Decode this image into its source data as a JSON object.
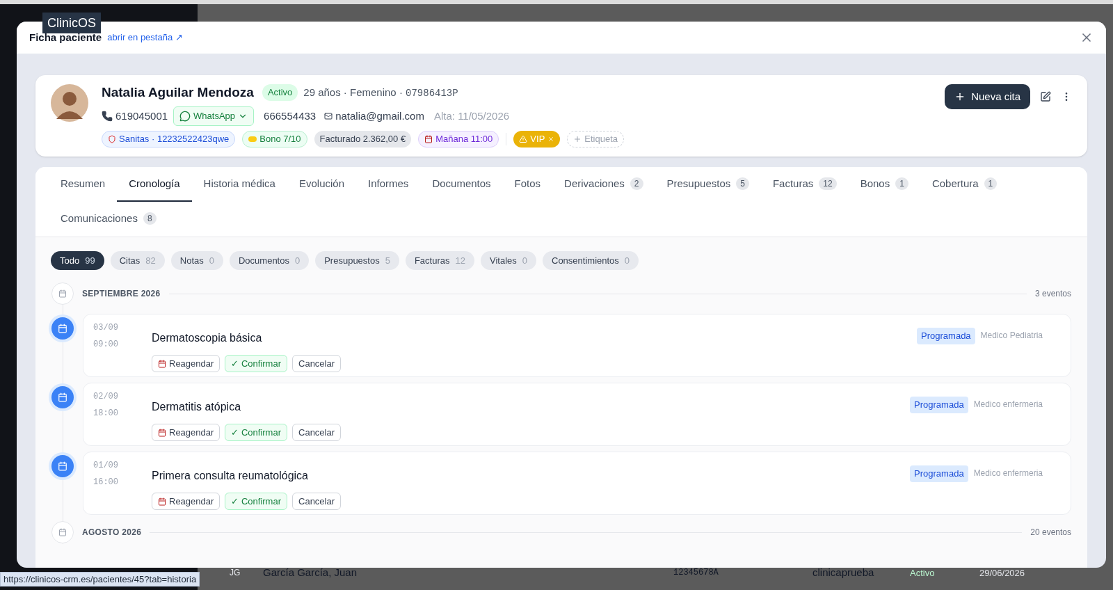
{
  "tooltip": "ClinicOS",
  "modal": {
    "title": "Ficha paciente",
    "open_tab_link": "abrir en pestaña ↗"
  },
  "patient": {
    "name": "Natalia Aguilar Mendoza",
    "status": "Activo",
    "info": "29 años · Femenino · ",
    "id": "07986413P",
    "phone": "619045001",
    "whatsapp": "WhatsApp",
    "phone2": "666554433",
    "email": "natalia@gmail.com",
    "since": "Alta: 11/05/2026",
    "tags": [
      {
        "kind": "insurance",
        "text": "Sanitas · 12232522423qwe"
      },
      {
        "kind": "bono",
        "text": "Bono 7/10"
      },
      {
        "kind": "billing",
        "text": "Facturado 2.362,00 €"
      },
      {
        "kind": "appointment",
        "text": "Mañana 11:00"
      },
      {
        "kind": "vip",
        "text": "VIP"
      },
      {
        "kind": "add",
        "text": "Etiqueta"
      }
    ],
    "new_button": "Nueva cita"
  },
  "tabs": [
    {
      "label": "Resumen",
      "selected": false
    },
    {
      "label": "Cronología",
      "selected": true
    },
    {
      "label": "Historia médica",
      "selected": false
    },
    {
      "label": "Evolución",
      "selected": false
    },
    {
      "label": "Informes",
      "selected": false
    },
    {
      "label": "Documentos",
      "selected": false
    },
    {
      "label": "Fotos",
      "selected": false
    },
    {
      "label": "Derivaciones",
      "count": "2",
      "selected": false
    },
    {
      "label": "Presupuestos",
      "count": "5",
      "selected": false
    },
    {
      "label": "Facturas",
      "count": "12",
      "selected": false
    },
    {
      "label": "Bonos",
      "count": "1",
      "selected": false
    },
    {
      "label": "Cobertura",
      "count": "1",
      "selected": false
    },
    {
      "label": "Comunicaciones",
      "count": "8",
      "selected": false
    }
  ],
  "filters": [
    {
      "label": "Todo",
      "count": "99",
      "selected": true
    },
    {
      "label": "Citas",
      "count": "82",
      "selected": false
    },
    {
      "label": "Notas",
      "count": "0",
      "selected": false
    },
    {
      "label": "Documentos",
      "count": "0",
      "selected": false
    },
    {
      "label": "Presupuestos",
      "count": "5",
      "selected": false
    },
    {
      "label": "Facturas",
      "count": "12",
      "selected": false
    },
    {
      "label": "Vitales",
      "count": "0",
      "selected": false
    },
    {
      "label": "Consentimientos",
      "count": "0",
      "selected": false
    }
  ],
  "groups": [
    {
      "month": "SEPTIEMBRE 2026",
      "count": "3 eventos",
      "events": [
        {
          "date": "03/09",
          "time": "09:00",
          "title": "Dermatoscopia básica",
          "status": "Programada",
          "doctor": "Medico Pediatria",
          "actions": [
            "Reagendar",
            "✓ Confirmar",
            "Cancelar"
          ]
        },
        {
          "date": "02/09",
          "time": "18:00",
          "title": "Dermatitis atópica",
          "status": "Programada",
          "doctor": "Medico enfermeria",
          "actions": [
            "Reagendar",
            "✓ Confirmar",
            "Cancelar"
          ]
        },
        {
          "date": "01/09",
          "time": "16:00",
          "title": "Primera consulta reumatológica",
          "status": "Programada",
          "doctor": "Medico enfermeria",
          "actions": [
            "Reagendar",
            "✓ Confirmar",
            "Cancelar"
          ]
        }
      ]
    },
    {
      "month": "AGOSTO 2026",
      "count": "20 eventos"
    }
  ],
  "background_row": {
    "initials": "JG",
    "name": "García García, Juan",
    "id": "12345678A",
    "clinic": "clinicaprueba",
    "status": "Activo",
    "date": "29/06/2026"
  },
  "status_url": "https://clinicos-crm.es/pacientes/45?tab=historia"
}
